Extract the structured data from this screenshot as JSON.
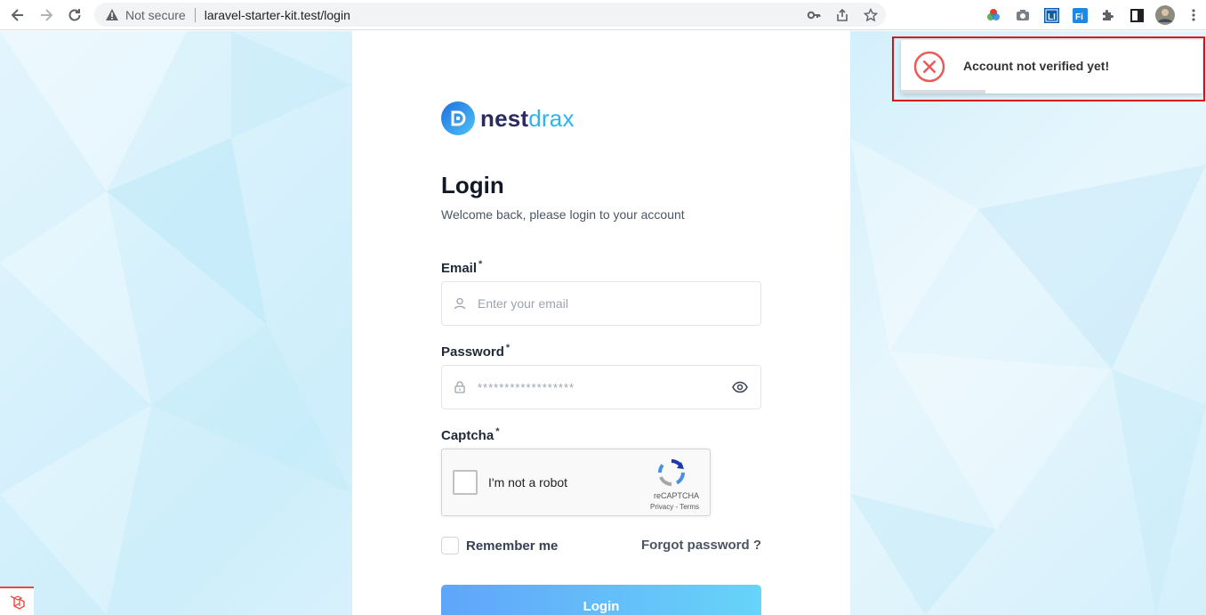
{
  "browser": {
    "security_label": "Not secure",
    "url": "laravel-starter-kit.test/login",
    "extensions": [
      "color-picker-icon",
      "camera-icon",
      "li-icon",
      "fi-icon",
      "puzzle-icon",
      "sidepanel-icon",
      "avatar"
    ]
  },
  "brand": {
    "part1": "nest",
    "part2": "drax"
  },
  "login": {
    "title": "Login",
    "subtitle": "Welcome back, please login to your account",
    "email_label": "Email",
    "email_placeholder": "Enter your email",
    "password_label": "Password",
    "password_value": "******************",
    "captcha_label": "Captcha",
    "required_mark": "*",
    "captcha": {
      "text": "I'm not a robot",
      "brand": "reCAPTCHA",
      "links": "Privacy - Terms"
    },
    "remember_label": "Remember me",
    "forgot_label": "Forgot password ?",
    "button_label": "Login"
  },
  "toast": {
    "message": "Account not verified yet!",
    "progress": 0.28
  },
  "colors": {
    "accent": "#60a5fa",
    "error": "#e95a5a",
    "highlight": "#e01010"
  }
}
